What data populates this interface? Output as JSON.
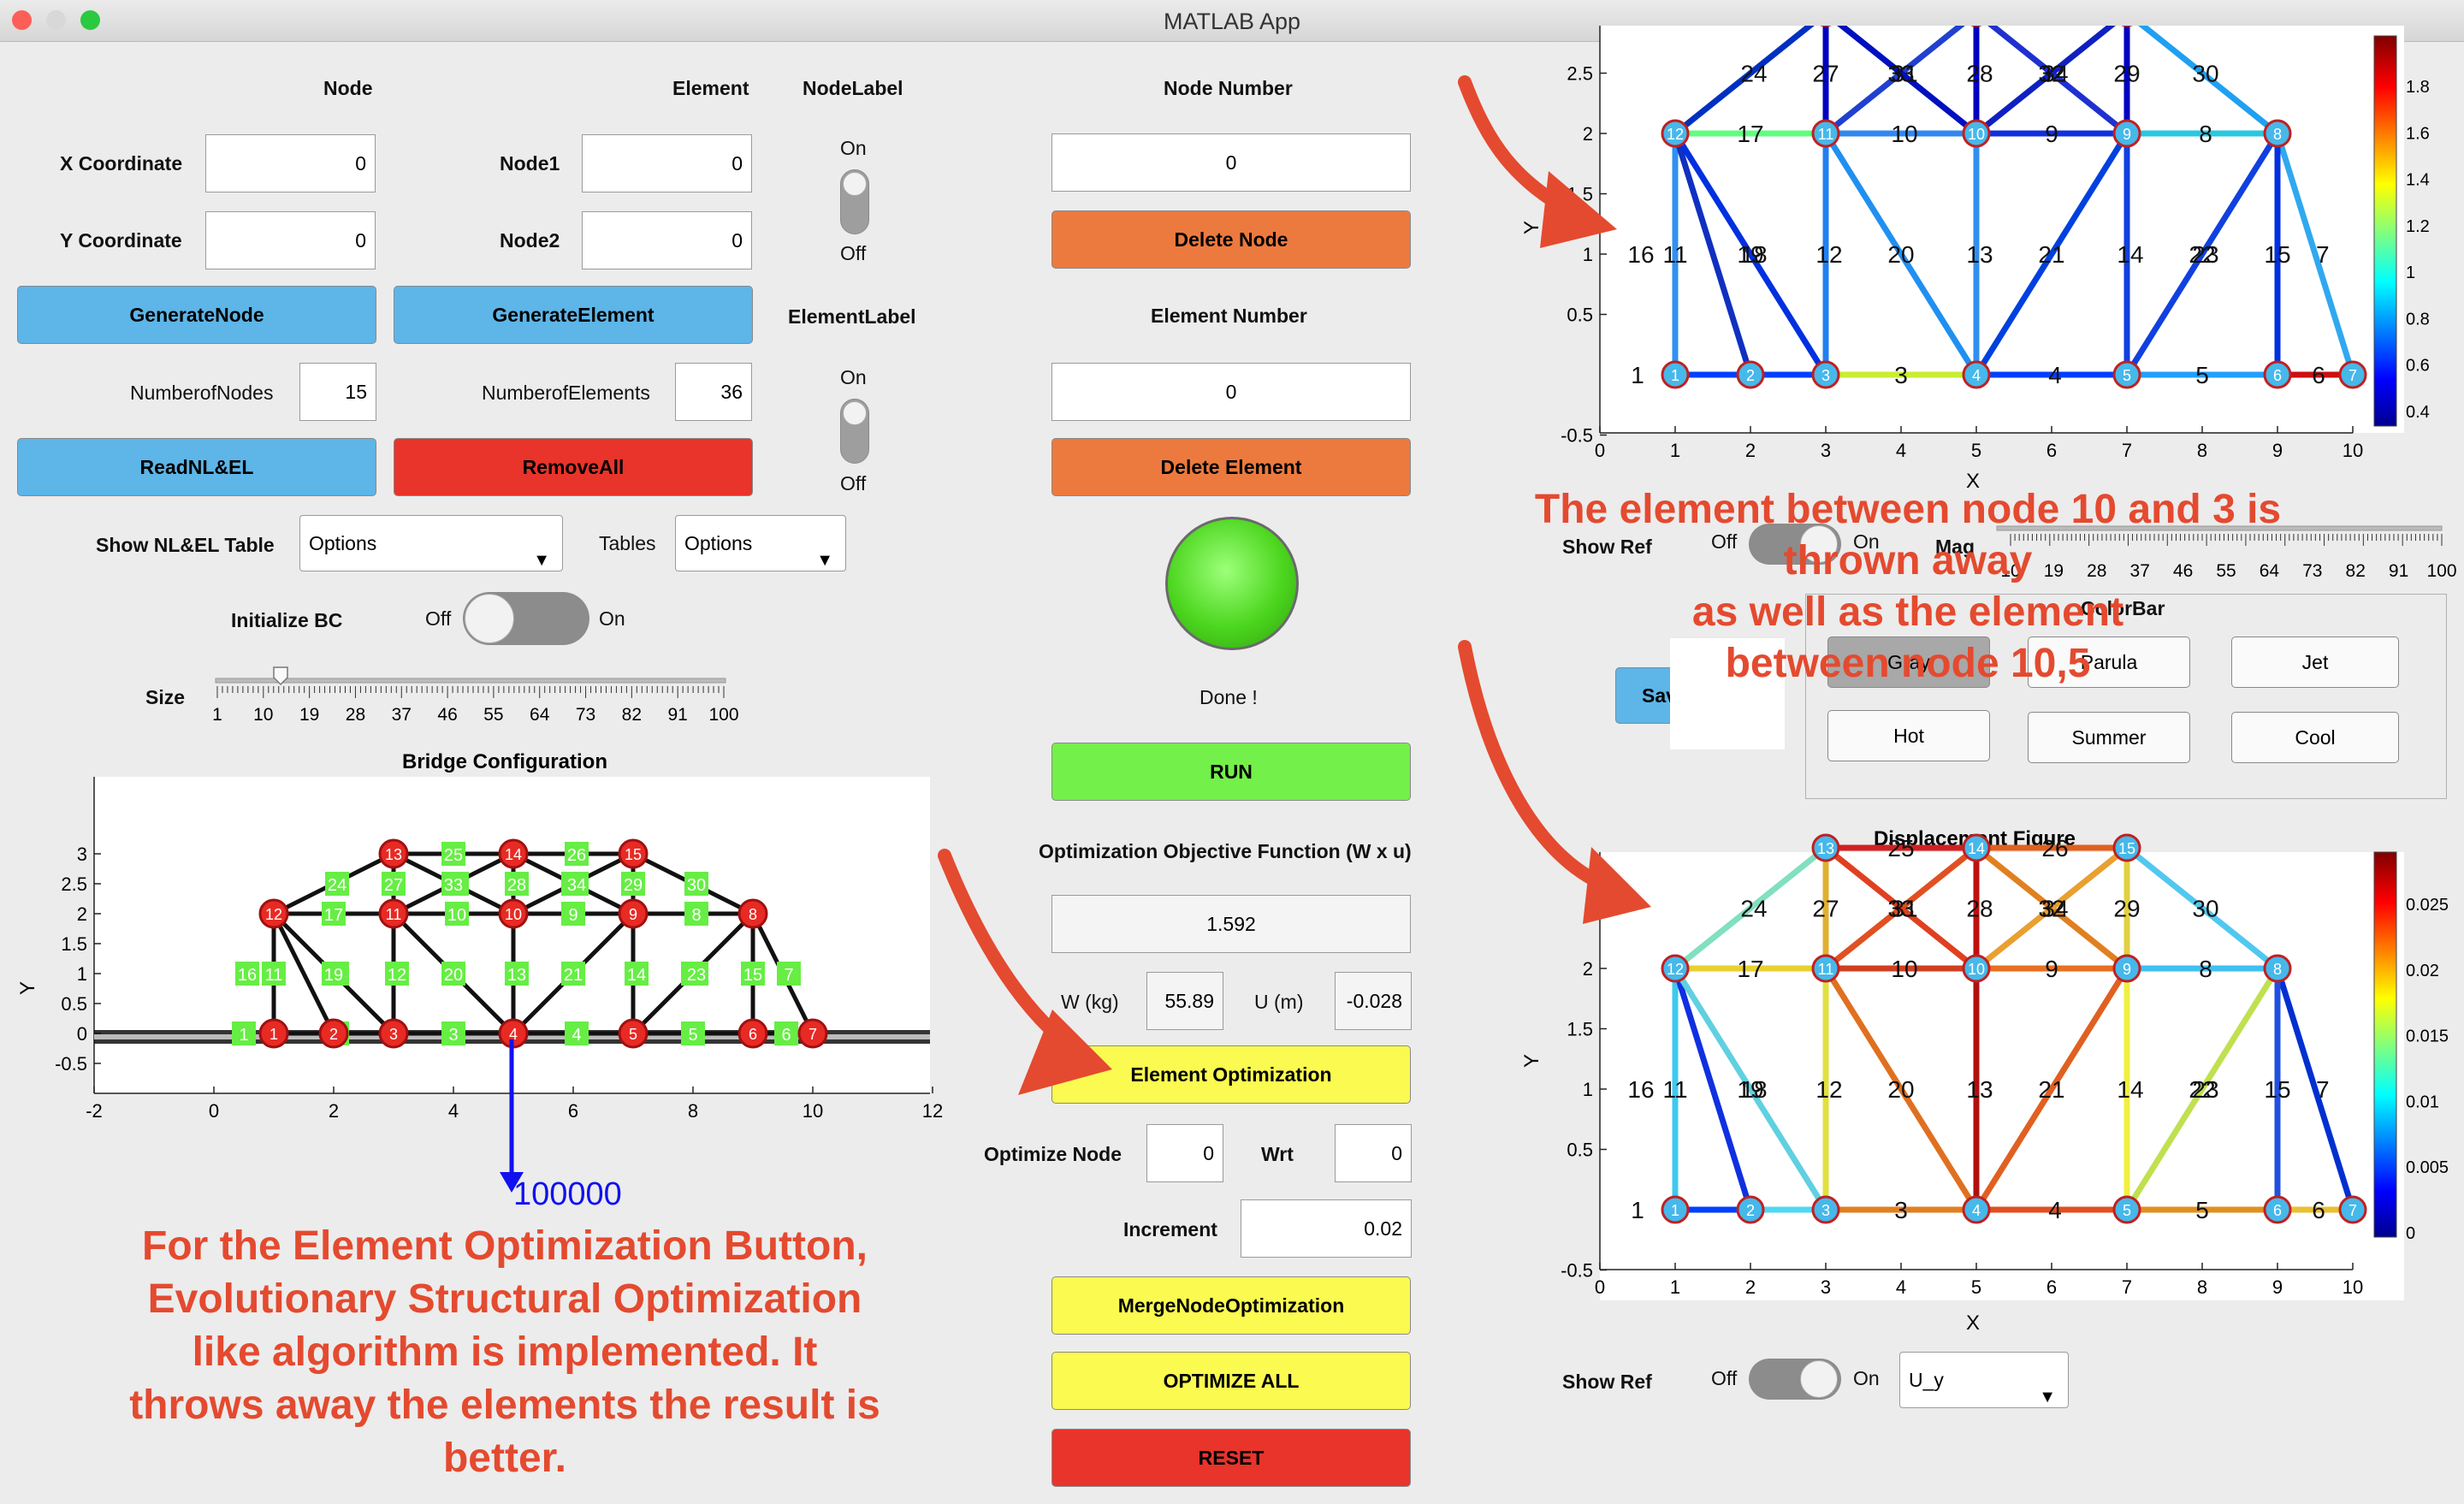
{
  "window": {
    "title": "MATLAB App"
  },
  "node_panel": {
    "node_header": "Node",
    "element_header": "Element",
    "nodelabel_header": "NodeLabel",
    "x_label": "X Coordinate",
    "x_value": "0",
    "y_label": "Y Coordinate",
    "y_value": "0",
    "node1_label": "Node1",
    "node1_value": "0",
    "node2_label": "Node2",
    "node2_value": "0",
    "nodelabel_on": "On",
    "nodelabel_off": "Off",
    "generate_node": "GenerateNode",
    "generate_element": "GenerateElement",
    "elementlabel_header": "ElementLabel",
    "elementlabel_on": "On",
    "elementlabel_off": "Off",
    "num_nodes_label": "NumberofNodes",
    "num_nodes_value": "15",
    "num_elements_label": "NumberofElements",
    "num_elements_value": "36",
    "read_button": "ReadNL&EL",
    "remove_button": "RemoveAll",
    "show_table_label": "Show NL&EL Table",
    "show_table_value": "Options",
    "tables_label": "Tables",
    "tables_value": "Options",
    "init_bc_label": "Initialize BC",
    "init_bc_off": "Off",
    "init_bc_on": "On",
    "size_label": "Size",
    "size_ticks": [
      "1",
      "10",
      "19",
      "28",
      "37",
      "46",
      "55",
      "64",
      "73",
      "82",
      "91",
      "100"
    ]
  },
  "center_panel": {
    "node_number_label": "Node Number",
    "node_number_value": "0",
    "delete_node": "Delete Node",
    "element_number_label": "Element Number",
    "element_number_value": "0",
    "delete_element": "Delete Element",
    "status_text": "Done !",
    "run_button": "RUN",
    "objective_label": "Optimization Objective Function (W x u)",
    "objective_value": "1.592",
    "w_label": "W (kg)",
    "w_value": "55.89",
    "u_label": "U (m)",
    "u_value": "-0.028",
    "element_opt_button": "Element Optimization",
    "optimize_node_label": "Optimize Node",
    "optimize_node_value": "0",
    "wrt_label": "Wrt",
    "wrt_value": "0",
    "increment_label": "Increment",
    "increment_value": "0.02",
    "merge_button": "MergeNodeOptimization",
    "optimize_all_button": "OPTIMIZE ALL",
    "reset_button": "RESET"
  },
  "right_panel": {
    "show_ref_label": "Show Ref",
    "show_ref_off": "Off",
    "show_ref_on": "On",
    "mag_label": "Mag",
    "mag_ticks": [
      "10",
      "19",
      "28",
      "37",
      "46",
      "55",
      "64",
      "73",
      "82",
      "91",
      "100"
    ],
    "colorbar_title": "ColorBar",
    "colormap_buttons": [
      "Gray",
      "Parula",
      "Jet",
      "Hot",
      "Summer",
      "Cool"
    ],
    "save_button": "Sav",
    "show_ref2_label": "Show Ref",
    "show_ref2_off": "Off",
    "show_ref2_on": "On",
    "component_value": "U_y"
  },
  "bridge_plot": {
    "title": "Bridge Configuration",
    "xlabel": "X",
    "ylabel": "Y",
    "load_label": "100000",
    "colors": {
      "node": "#e82a24",
      "element_label_bg": "#66ee44",
      "load": "#1111ee"
    }
  },
  "stress_plot": {
    "xlabel": "X",
    "ylabel": "Y",
    "colorbar_ticks": [
      "0.4",
      "0.6",
      "0.8",
      "1",
      "1.2",
      "1.4",
      "1.6",
      "1.8"
    ]
  },
  "disp_plot": {
    "title": "Displacement Figure",
    "xlabel": "X",
    "ylabel": "Y",
    "colorbar_ticks": [
      "0",
      "0.005",
      "0.01",
      "0.015",
      "0.02",
      "0.025"
    ]
  },
  "annotations": {
    "top_right": [
      "The element between node 10 and 3 is",
      "thrown away",
      "as well as the element",
      "between node 10,5"
    ],
    "bottom_left": [
      "For the Element Optimization Button,",
      "Evolutionary Structural Optimization",
      "like algorithm is implemented. It",
      "throws away the elements the result is",
      "better."
    ]
  },
  "truss": {
    "nodes": [
      [
        0,
        0
      ],
      [
        1,
        0
      ],
      [
        2,
        0
      ],
      [
        3,
        0
      ],
      [
        5,
        0
      ],
      [
        7,
        0
      ],
      [
        9,
        0
      ],
      [
        10,
        0
      ],
      [
        9,
        2
      ],
      [
        7,
        2
      ],
      [
        5,
        2
      ],
      [
        3,
        2
      ],
      [
        1,
        2
      ],
      [
        3,
        3
      ],
      [
        5,
        3
      ],
      [
        7,
        3
      ]
    ],
    "elements": [
      [
        1,
        2
      ],
      [
        2,
        3
      ],
      [
        3,
        4
      ],
      [
        4,
        5
      ],
      [
        5,
        6
      ],
      [
        6,
        7
      ],
      [
        7,
        8
      ],
      [
        8,
        9
      ],
      [
        9,
        10
      ],
      [
        10,
        11
      ],
      [
        11,
        12
      ],
      [
        12,
        1
      ],
      [
        12,
        2
      ],
      [
        12,
        3
      ],
      [
        11,
        3
      ],
      [
        11,
        4
      ],
      [
        10,
        4
      ],
      [
        9,
        4
      ],
      [
        9,
        5
      ],
      [
        8,
        5
      ],
      [
        8,
        6
      ],
      [
        11,
        14
      ],
      [
        10,
        14
      ],
      [
        9,
        14
      ],
      [
        13,
        14
      ],
      [
        14,
        15
      ],
      [
        11,
        13
      ],
      [
        10,
        13
      ],
      [
        9,
        15
      ],
      [
        10,
        15
      ],
      [
        8,
        15
      ],
      [
        12,
        13
      ]
    ],
    "node_labels": [
      "1",
      "2",
      "3",
      "4",
      "5",
      "6",
      "7",
      "8",
      "9",
      "10",
      "11",
      "12",
      "13",
      "14",
      "15"
    ],
    "element_labels": [
      {
        "t": "1",
        "x": 0.5,
        "y": 0
      },
      {
        "t": "2",
        "x": 2,
        "y": 0
      },
      {
        "t": "3",
        "x": 4,
        "y": 0
      },
      {
        "t": "4",
        "x": 6,
        "y": 0
      },
      {
        "t": "5",
        "x": 8,
        "y": 0
      },
      {
        "t": "6",
        "x": 9.5,
        "y": 0
      },
      {
        "t": "7",
        "x": 9.6,
        "y": 1
      },
      {
        "t": "8",
        "x": 8,
        "y": 2
      },
      {
        "t": "9",
        "x": 6,
        "y": 2
      },
      {
        "t": "10",
        "x": 4,
        "y": 2
      },
      {
        "t": "17",
        "x": 2,
        "y": 2
      },
      {
        "t": "16",
        "x": 0.5,
        "y": 1
      },
      {
        "t": "11",
        "x": 1,
        "y": 1
      },
      {
        "t": "18",
        "x": 2,
        "y": 1
      },
      {
        "t": "19",
        "x": 2,
        "y": 1
      },
      {
        "t": "12",
        "x": 3,
        "y": 1
      },
      {
        "t": "20",
        "x": 4,
        "y": 1
      },
      {
        "t": "13",
        "x": 5,
        "y": 1
      },
      {
        "t": "21",
        "x": 6,
        "y": 1
      },
      {
        "t": "14",
        "x": 7,
        "y": 1
      },
      {
        "t": "22",
        "x": 8,
        "y": 1
      },
      {
        "t": "23",
        "x": 8,
        "y": 1
      },
      {
        "t": "15",
        "x": 9,
        "y": 1
      },
      {
        "t": "24",
        "x": 2,
        "y": 2.5
      },
      {
        "t": "27",
        "x": 3,
        "y": 2.5
      },
      {
        "t": "31",
        "x": 4,
        "y": 2.5
      },
      {
        "t": "33",
        "x": 4,
        "y": 2.5
      },
      {
        "t": "28",
        "x": 5,
        "y": 2.5
      },
      {
        "t": "32",
        "x": 6,
        "y": 2.5
      },
      {
        "t": "34",
        "x": 6,
        "y": 2.5
      },
      {
        "t": "29",
        "x": 7,
        "y": 2.5
      },
      {
        "t": "30",
        "x": 8,
        "y": 2.5
      },
      {
        "t": "25",
        "x": 4,
        "y": 3
      },
      {
        "t": "26",
        "x": 6,
        "y": 3
      }
    ],
    "stress_colors": [
      "#0040ff",
      "#0040ff",
      "#c8ee30",
      "#0040ff",
      "#20a0ff",
      "#cc1010",
      "#30a8f0",
      "#28c8e0",
      "#1030e0",
      "#3088f0",
      "#60ff80",
      "#3090f0",
      "#1030c0",
      "#0030e0",
      "#2080f0",
      "#2090f0",
      "#3090f0",
      "#0040e0",
      "#1040e0",
      "#1040e0",
      "#0030e0",
      "#2040d0",
      "#0000c0",
      "#2030d0",
      "#0000b0",
      "#1020c0",
      "#0000c0",
      "#0010c0",
      "#0000c0",
      "#1020c0",
      "#20a0f0",
      "#0030c0"
    ],
    "disp_colors": [
      "#0040ff",
      "#50d8f0",
      "#e08020",
      "#e05020",
      "#e09020",
      "#e8c030",
      "#0030d0",
      "#40c0f0",
      "#e87020",
      "#d04020",
      "#e8d030",
      "#40c8f0",
      "#1030e0",
      "#60d0e0",
      "#e0e040",
      "#e07020",
      "#b01010",
      "#e06020",
      "#f0f040",
      "#c0e050",
      "#2050e0",
      "#e05020",
      "#c01010",
      "#e08020",
      "#d02020",
      "#e06020",
      "#e0b030",
      "#e04020",
      "#e0d040",
      "#e8a030",
      "#50c8f0",
      "#80e0c0"
    ]
  }
}
